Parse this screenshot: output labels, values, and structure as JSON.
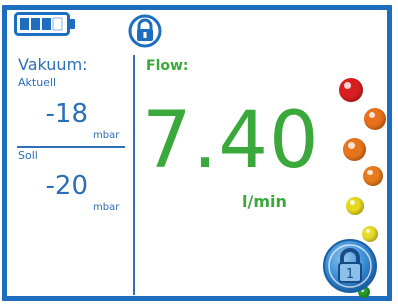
{
  "status": {
    "battery_icon": "battery-icon",
    "lock_icon": "lock-icon"
  },
  "vacuum": {
    "title": "Vakuum:",
    "actual": {
      "label": "Aktuell",
      "value": "-18",
      "unit": "mbar"
    },
    "target": {
      "label": "Soll",
      "value": "-20",
      "unit": "mbar"
    }
  },
  "flow": {
    "label": "Flow:",
    "value": "7.40",
    "unit": "l/min"
  },
  "indicator_colors": [
    "#d81f1f",
    "#e86f1c",
    "#e8741c",
    "#e97a1c",
    "#e8d91f",
    "#e6de2a",
    "#2aa02a"
  ],
  "lock_button": {
    "icon": "lock-1-icon",
    "number": "1"
  },
  "colors": {
    "frame": "#1e6ec0",
    "text_blue": "#2d6fb6",
    "flow_green": "#3aa83a"
  }
}
